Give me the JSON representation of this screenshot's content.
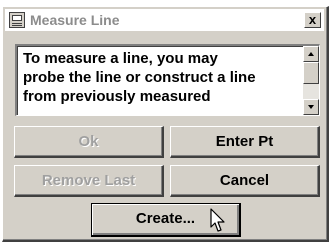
{
  "window": {
    "title": "Measure Line",
    "icon": "calculator-icon",
    "close_glyph": "x"
  },
  "message": {
    "text": "To measure a line, you may\nprobe the line or construct a line\nfrom previously measured"
  },
  "buttons": {
    "ok": "Ok",
    "enter_pt": "Enter Pt",
    "remove_last": "Remove Last",
    "cancel": "Cancel",
    "create": "Create..."
  },
  "cursor": "arrow-cursor-icon",
  "colors": {
    "dialog_face": "#d4d0c8",
    "title_text_inactive": "#8c8c8c",
    "disabled_text": "#a0a0a0"
  }
}
